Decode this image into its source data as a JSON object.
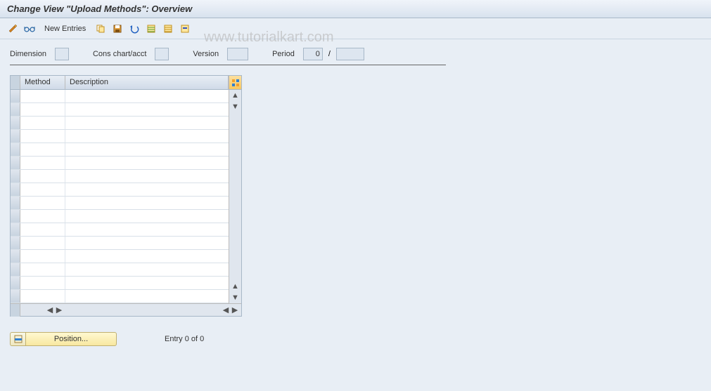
{
  "title": "Change View \"Upload Methods\": Overview",
  "toolbar": {
    "new_entries_label": "New Entries"
  },
  "filters": {
    "dimension_label": "Dimension",
    "dimension_value": "",
    "chart_label": "Cons chart/acct",
    "chart_value": "",
    "version_label": "Version",
    "version_value": "",
    "period_label": "Period",
    "period_value": "0",
    "period_sep": "/",
    "period2_value": ""
  },
  "table": {
    "col_method": "Method",
    "col_description": "Description"
  },
  "footer": {
    "position_label": "Position...",
    "entry_status": "Entry 0 of 0"
  },
  "watermark": "www.tutorialkart.com"
}
